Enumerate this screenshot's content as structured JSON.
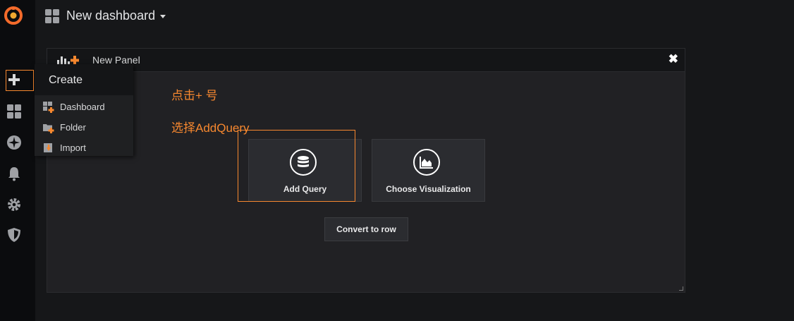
{
  "topbar": {
    "title": "New dashboard"
  },
  "panel": {
    "title": "New Panel",
    "close_glyph": "✖"
  },
  "cards": [
    {
      "label": "Add Query",
      "icon": "database-icon"
    },
    {
      "label": "Choose Visualization",
      "icon": "area-chart-icon"
    }
  ],
  "convert_button": {
    "label": "Convert to row"
  },
  "create_menu": {
    "title": "Create",
    "items": [
      {
        "label": "Dashboard",
        "icon": "dashboard-plus-icon"
      },
      {
        "label": "Folder",
        "icon": "folder-plus-icon"
      },
      {
        "label": "Import",
        "icon": "import-icon"
      }
    ]
  },
  "annotations": {
    "step1": "点击+ 号",
    "step2": "选择AddQuery"
  },
  "colors": {
    "accent": "#f7882f",
    "background": "#161719",
    "panel": "#212124",
    "sidebar": "#0b0c0e"
  }
}
